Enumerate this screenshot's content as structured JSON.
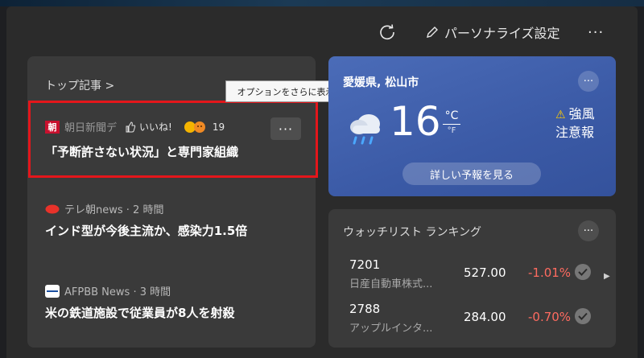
{
  "topbar": {
    "refresh_icon": "refresh-icon",
    "personalize_label": "パーソナライズ設定",
    "more_label": "···"
  },
  "news": {
    "section_title": "トップ記事 >",
    "tooltip": "オプションをさらに表示",
    "items": [
      {
        "source": "朝日新聞デ",
        "source_logo": "朝",
        "like_label": "いいね!",
        "reaction_count": "19",
        "more_label": "···",
        "headline": "「予断許さない状況」と専門家組織"
      },
      {
        "source": "テレ朝news · 2 時間",
        "headline": "インド型が今後主流か、感染力1.5倍"
      },
      {
        "source": "AFPBB News · 3 時間",
        "headline": "米の鉄道施設で従業員が8人を射殺"
      }
    ]
  },
  "weather": {
    "location": "愛媛県, 松山市",
    "temperature": "16",
    "unit_c": "°C",
    "unit_f": "°F",
    "alert_line1": "強風",
    "alert_line2": "注意報",
    "forecast_button": "詳しい予報を見る",
    "more_label": "···"
  },
  "watchlist": {
    "title": "ウォッチリスト ランキング",
    "more_label": "···",
    "stocks": [
      {
        "code": "7201",
        "name": "日産自動車株式...",
        "price": "527.00",
        "change": "-1.01%"
      },
      {
        "code": "2788",
        "name": "アップルインタ...",
        "price": "284.00",
        "change": "-0.70%"
      }
    ]
  },
  "colors": {
    "highlight": "#e4161b",
    "negative": "#ff6b60",
    "weather_bg": "#3b5aa6"
  }
}
